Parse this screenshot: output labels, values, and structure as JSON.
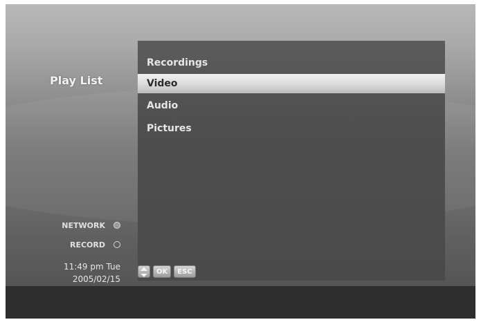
{
  "menu": {
    "title": "Play List",
    "items": [
      {
        "label": "Recordings",
        "selected": false
      },
      {
        "label": "Video",
        "selected": true
      },
      {
        "label": "Audio",
        "selected": false
      },
      {
        "label": "Pictures",
        "selected": false
      }
    ]
  },
  "status": {
    "network_label": "NETWORK",
    "network_indicator": "on",
    "record_label": "RECORD",
    "record_indicator": "off",
    "time": "11:49 pm Tue",
    "date": "2005/02/15"
  },
  "keys": {
    "navigate_icon": "up-down-arrows-icon",
    "ok_label": "OK",
    "esc_label": "ESC"
  }
}
